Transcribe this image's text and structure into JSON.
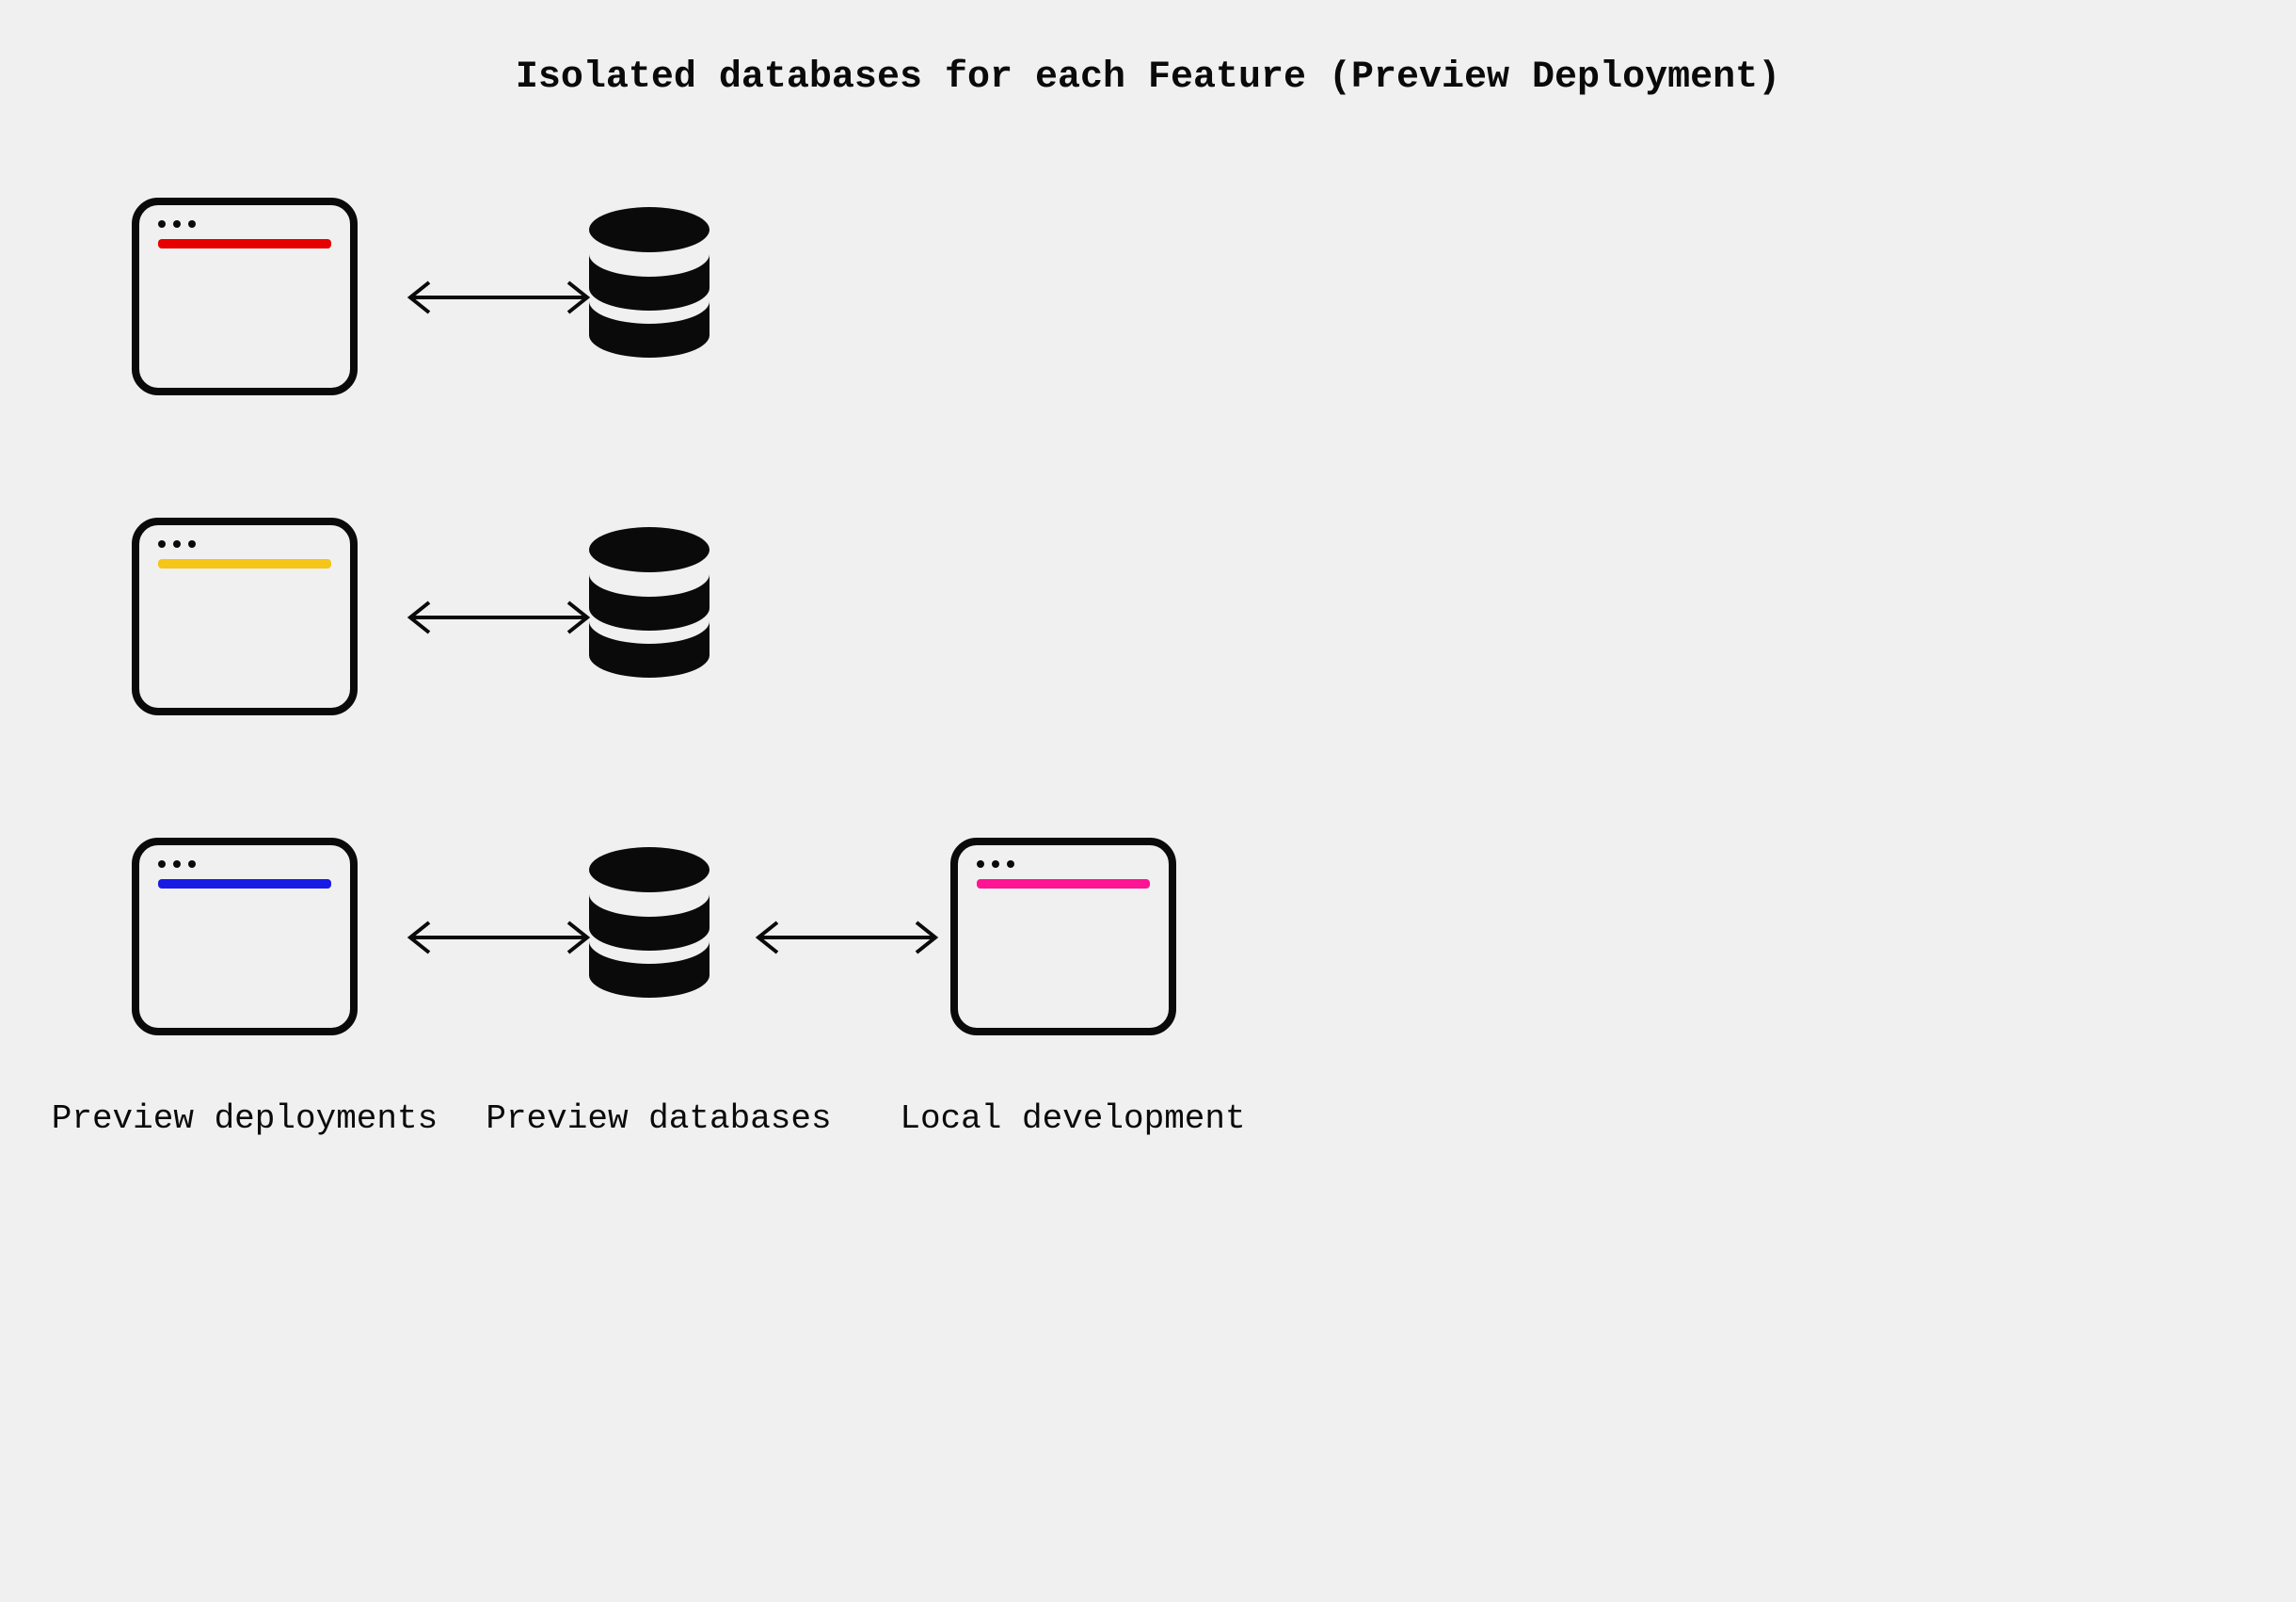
{
  "title": "Isolated databases for each Feature (Preview Deployment)",
  "columns": {
    "preview_deployments": "Preview deployments",
    "preview_databases": "Preview databases",
    "local_development": "Local development"
  },
  "deployments": [
    {
      "accent": "#e60000"
    },
    {
      "accent": "#f5c518"
    },
    {
      "accent": "#1a1ae6"
    }
  ],
  "local_accent": "#ff1493"
}
